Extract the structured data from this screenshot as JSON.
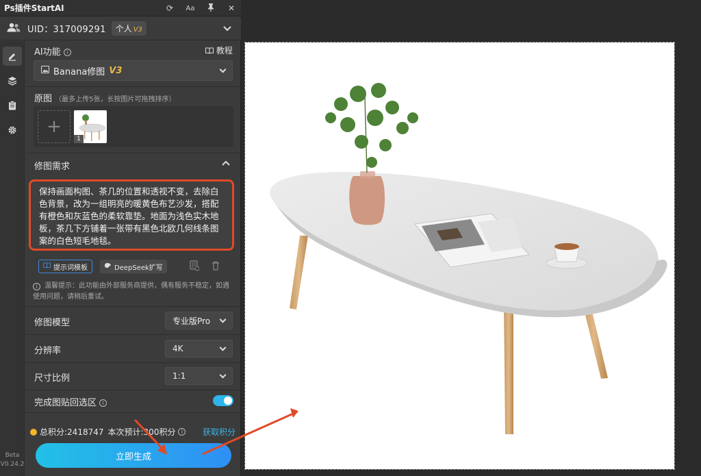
{
  "titlebar": {
    "title": "Ps插件StartAI",
    "icons": [
      "refresh-icon",
      "font-icon",
      "pin-icon",
      "close-icon"
    ],
    "font_label": "Aa"
  },
  "account": {
    "uid_text": "UID：317009291",
    "plan_label": "个人",
    "plan_version": "V3"
  },
  "ai_function": {
    "label": "AI功能",
    "tutorial_label": "教程",
    "selected": "Banana修图",
    "selected_version": "V3"
  },
  "source_images": {
    "label": "原图",
    "hint": "（最多上传5张，长按图片可拖拽排序）",
    "thumb_index": "1"
  },
  "edit_request": {
    "label": "修图需求",
    "prompt": "保持画面构图、茶几的位置和透视不变，去除白色背景，改为一组明亮的暖黄色布艺沙发，搭配有橙色和灰蓝色的柔软靠垫。地面为浅色实木地板，茶几下方铺着一张带有黑色北欧几何线条图案的白色短毛地毯。",
    "template_button": "提示词模板",
    "deepseek_button": "DeepSeek扩写",
    "notice": "温馨提示：此功能由外部服务商提供，偶有服务不稳定，如遇使用问题，请稍后重试。"
  },
  "settings": {
    "model_label": "修图模型",
    "model_value": "专业版Pro",
    "resolution_label": "分辨率",
    "resolution_value": "4K",
    "ratio_label": "尺寸比例",
    "ratio_value": "1:1",
    "paste_back_label": "完成图贴回选区",
    "paste_back_on": true
  },
  "footer": {
    "total_points": "总积分:2418747",
    "estimate": "本次预计:300积分",
    "get_points": "获取积分",
    "generate_button": "立即生成",
    "beta_label": "Beta",
    "version_label": "V0.24.2"
  },
  "colors": {
    "accent_blue": "#2eb4e8",
    "highlight_red": "#e04a28",
    "version_gold": "#e8b84a"
  }
}
